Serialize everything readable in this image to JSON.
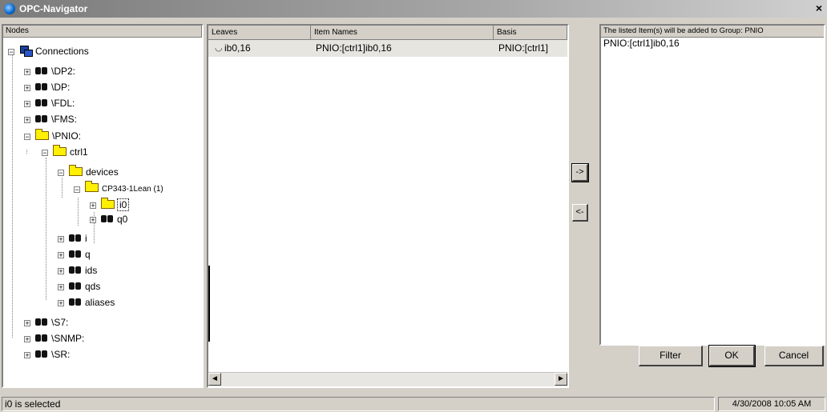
{
  "window": {
    "title": "OPC-Navigator",
    "close_glyph": "×"
  },
  "tree": {
    "header": "Nodes",
    "nodes": [
      {
        "label": "Connections",
        "icon": "connections-icon"
      },
      {
        "label": "\\DP2:",
        "icon": "binoculars-icon"
      },
      {
        "label": "\\DP:",
        "icon": "binoculars-icon"
      },
      {
        "label": "\\FDL:",
        "icon": "binoculars-icon"
      },
      {
        "label": "\\FMS:",
        "icon": "binoculars-icon"
      },
      {
        "label": "\\PNIO:",
        "icon": "folder-icon"
      },
      {
        "label": "ctrl1",
        "icon": "folder-icon"
      },
      {
        "label": "devices",
        "icon": "folder-icon"
      },
      {
        "label": "CP343-1Lean (1)",
        "icon": "folder-icon"
      },
      {
        "label": "i0",
        "icon": "folder-icon",
        "selected": true
      },
      {
        "label": "q0",
        "icon": "binoculars-icon"
      },
      {
        "label": "i",
        "icon": "binoculars-icon"
      },
      {
        "label": "q",
        "icon": "binoculars-icon"
      },
      {
        "label": "ids",
        "icon": "binoculars-icon"
      },
      {
        "label": "qds",
        "icon": "binoculars-icon"
      },
      {
        "label": "aliases",
        "icon": "binoculars-icon"
      },
      {
        "label": "\\S7:",
        "icon": "binoculars-icon"
      },
      {
        "label": "\\SNMP:",
        "icon": "binoculars-icon"
      },
      {
        "label": "\\SR:",
        "icon": "binoculars-icon"
      }
    ]
  },
  "items": {
    "columns": [
      "Leaves",
      "Item Names",
      "Basis"
    ],
    "rows": [
      {
        "leaf": "ib0,16",
        "item_name": "PNIO:[ctrl1]ib0,16",
        "basis": "PNIO:[ctrl1]"
      }
    ],
    "scroll_left": "◄",
    "scroll_right": "►"
  },
  "arrows": {
    "add": "->",
    "remove": "<-"
  },
  "selected_items": {
    "header": "The listed Item(s) will be added to Group: PNIO",
    "items": [
      "PNIO:[ctrl1]ib0,16"
    ]
  },
  "buttons": {
    "filter": "Filter",
    "ok": "OK",
    "cancel": "Cancel"
  },
  "status": {
    "message": "i0 is selected",
    "datetime": "4/30/2008  10:05 AM"
  }
}
